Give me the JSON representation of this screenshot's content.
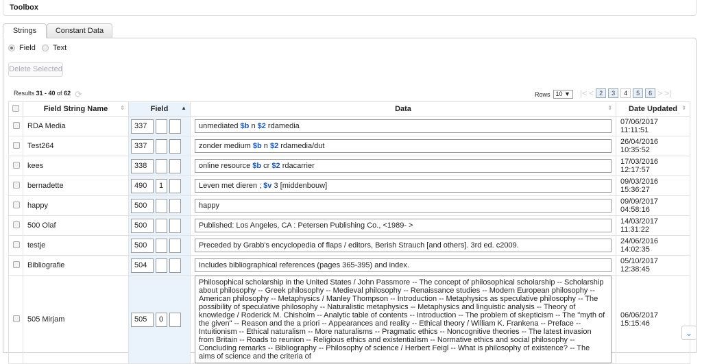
{
  "toolbox": {
    "title": "Toolbox"
  },
  "tabs": [
    {
      "label": "Strings",
      "active": true
    },
    {
      "label": "Constant Data",
      "active": false
    }
  ],
  "mode": {
    "options": [
      "Field",
      "Text"
    ],
    "selected": "Field"
  },
  "delete_button": "Delete Selected",
  "results": {
    "prefix": "Results ",
    "range": "31 - 40",
    "of": " of ",
    "total": "62"
  },
  "rows_label": "Rows",
  "rows_value": "10 ▼",
  "pager": {
    "pages": [
      "2",
      "3",
      "4",
      "5",
      "6"
    ],
    "current": "4"
  },
  "columns": [
    "Field String Name",
    "Field",
    "Data",
    "Date Updated"
  ],
  "rows": [
    {
      "name": "RDA Media",
      "tag": "337",
      "ind1": "",
      "ind2": "",
      "data": "unmediated $b n $2 rdamedia",
      "date": "07/06/2017 11:11:51"
    },
    {
      "name": "Test264",
      "tag": "337",
      "ind1": "",
      "ind2": "",
      "data": "zonder medium $b n $2 rdamedia/dut",
      "date": "26/04/2016 10:35:52"
    },
    {
      "name": "kees",
      "tag": "338",
      "ind1": "",
      "ind2": "",
      "data": "online resource $b cr $2 rdacarrier",
      "date": "17/03/2016 12:17:57"
    },
    {
      "name": "bernadette",
      "tag": "490",
      "ind1": "1",
      "ind2": "",
      "data": "Leven met dieren ; $v 3 [middenbouw]",
      "date": "09/03/2016 15:36:27"
    },
    {
      "name": "happy",
      "tag": "500",
      "ind1": "",
      "ind2": "",
      "data": "happy",
      "date": "09/09/2017 04:58:16"
    },
    {
      "name": "500 Olaf",
      "tag": "500",
      "ind1": "",
      "ind2": "",
      "data": "Published: Los Angeles, CA : Petersen Publishing Co., <1989- >",
      "date": "14/03/2017 11:31:22"
    },
    {
      "name": "testje",
      "tag": "500",
      "ind1": "",
      "ind2": "",
      "data": "Preceded by Grabb's encyclopedia of flaps / editors, Berish Strauch [and others]. 3rd ed. c2009.",
      "date": "24/06/2016 14:02:35"
    },
    {
      "name": "Bibliografie",
      "tag": "504",
      "ind1": "",
      "ind2": "",
      "data": "Includes bibliographical references (pages 365-395) and index.",
      "date": "05/10/2017 12:38:45"
    },
    {
      "name": "505 Mirjam",
      "tag": "505",
      "ind1": "0",
      "ind2": "",
      "data": "Philosophical scholarship in the United States / John Passmore -- The concept of philosophical scholarship -- Scholarship about philosophy -- Greek philosophy -- Medieval philosophy -- Renaissance studies -- Modern European philosophy -- American philosophy -- Metaphysics / Manley Thompson -- Introduction -- Metaphysics as speculative philosophy -- The possibility of speculative philosophy -- Naturalistic metaphysics -- Metaphysics and linguistic analysis -- Theory of knowledge / Roderick M. Chisholm -- Analytic table of contents -- Introduction -- The problem of skepticism -- The \"myth of the given\" -- Reason and the a priori -- Appearances and reality -- Ethical theory / William K. Frankena -- Preface -- Intuitionism -- Ethical naturalism -- More naturalisms -- Pragmatic ethics -- Noncognitive theories -- The latest invasion from Britain -- Roads to reunion -- Religious ethics and existentialism -- Normative ethics and social philosophy -- Concluding remarks -- Bibliography -- Philosophy of science / Herbert Feigl -- What is philosophy of existence? -- The aims of science and the criteria of",
      "date": "06/06/2017 15:15:46"
    }
  ],
  "colors": {
    "subfield": "#1a56b0",
    "sorted_column": "#eaf2fc"
  }
}
